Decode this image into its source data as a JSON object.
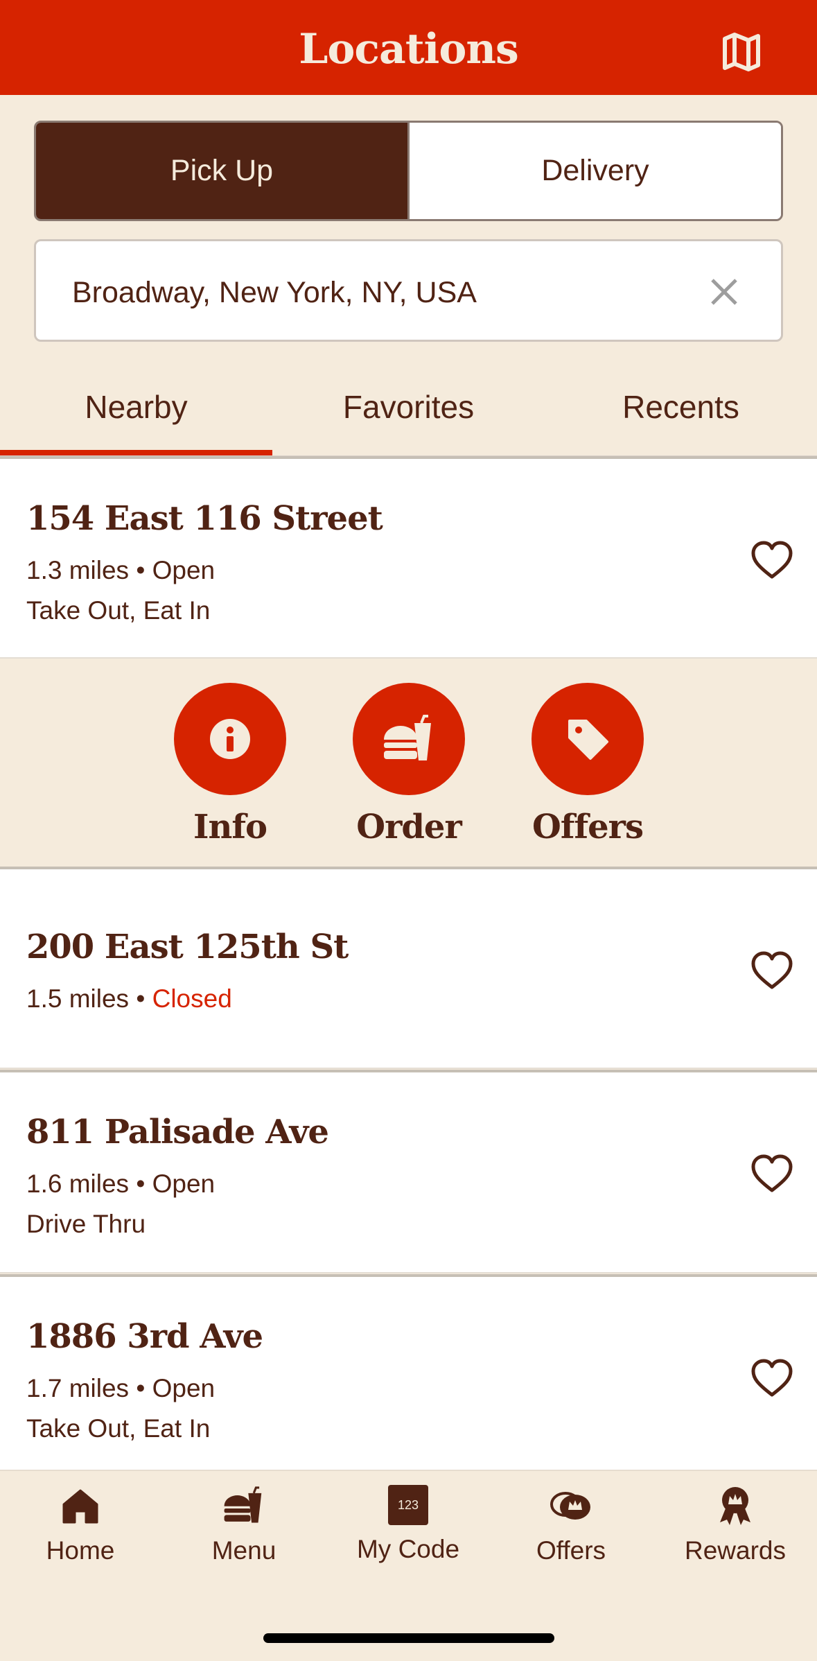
{
  "header": {
    "title": "Locations",
    "map_icon": "map-icon"
  },
  "toggle": {
    "pickup_label": "Pick Up",
    "delivery_label": "Delivery",
    "selected": "Pick Up"
  },
  "search": {
    "value": "Broadway, New York, NY, USA",
    "clear_icon": "close-icon"
  },
  "tabs": [
    {
      "label": "Nearby",
      "active": true
    },
    {
      "label": "Favorites",
      "active": false
    },
    {
      "label": "Recents",
      "active": false
    }
  ],
  "locations": [
    {
      "name": "154 East 116 Street",
      "distance": "1.3 miles",
      "sep": "•",
      "status": "Open",
      "services": "Take Out, Eat In"
    },
    {
      "name": "200 East 125th St",
      "distance": "1.5 miles",
      "sep": "•",
      "status": "Closed",
      "services": ""
    },
    {
      "name": "811 Palisade Ave",
      "distance": "1.6 miles",
      "sep": "•",
      "status": "Open",
      "services": "Drive Thru"
    },
    {
      "name": "1886 3rd Ave",
      "distance": "1.7 miles",
      "sep": "•",
      "status": "Open",
      "services": "Take Out, Eat In"
    }
  ],
  "actions": [
    {
      "label": "Info",
      "icon": "info-icon"
    },
    {
      "label": "Order",
      "icon": "burger-drink-icon"
    },
    {
      "label": "Offers",
      "icon": "tag-icon"
    }
  ],
  "bottom_nav": [
    {
      "label": "Home",
      "icon": "home-icon"
    },
    {
      "label": "Menu",
      "icon": "burger-drink-icon"
    },
    {
      "label": "My Code",
      "icon": "code-icon",
      "icon_text": "123"
    },
    {
      "label": "Offers",
      "icon": "offers-icon"
    },
    {
      "label": "Rewards",
      "icon": "rewards-icon"
    }
  ],
  "colors": {
    "brand_red": "#d62300",
    "brown": "#502314",
    "cream": "#f5ebdc"
  }
}
